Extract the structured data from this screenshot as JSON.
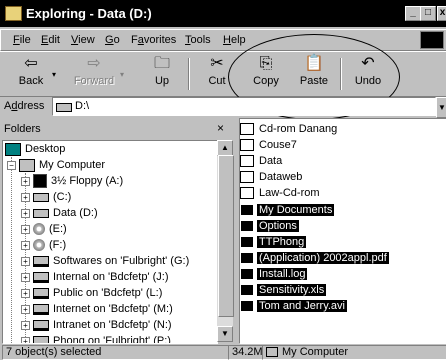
{
  "window": {
    "title": "Exploring - Data (D:)",
    "caption_buttons": {
      "minimize": "_",
      "maximize": "□",
      "close": "x"
    }
  },
  "menu": [
    {
      "label": "File",
      "accel": "F"
    },
    {
      "label": "Edit",
      "accel": "E"
    },
    {
      "label": "View",
      "accel": "V"
    },
    {
      "label": "Go",
      "accel": "G"
    },
    {
      "label": "Favorites",
      "accel": "a"
    },
    {
      "label": "Tools",
      "accel": "T"
    },
    {
      "label": "Help",
      "accel": "H"
    }
  ],
  "toolbar": {
    "back": {
      "label": "Back",
      "icon": "back-arrow-icon"
    },
    "forward": {
      "label": "Forward",
      "icon": "forward-arrow-icon"
    },
    "up": {
      "label": "Up",
      "icon": "up-folder-icon"
    },
    "cut": {
      "label": "Cut",
      "icon": "scissors-icon"
    },
    "copy": {
      "label": "Copy",
      "icon": "copy-icon"
    },
    "paste": {
      "label": "Paste",
      "icon": "paste-icon"
    },
    "undo": {
      "label": "Undo",
      "icon": "undo-icon"
    }
  },
  "address": {
    "label": "Address",
    "accel": "d",
    "value": "D:\\"
  },
  "folders_pane": {
    "header": "Folders",
    "close": "×",
    "tree": [
      {
        "label": "Desktop",
        "icon": "desktop-icon"
      },
      {
        "label": "My Computer",
        "icon": "computer-icon"
      },
      {
        "label": "3½ Floppy (A:)",
        "icon": "floppy-icon"
      },
      {
        "label": "(C:)",
        "icon": "hard-drive-icon"
      },
      {
        "label": "Data (D:)",
        "icon": "hard-drive-icon"
      },
      {
        "label": "(E:)",
        "icon": "cd-drive-icon"
      },
      {
        "label": "(F:)",
        "icon": "cd-drive-icon"
      },
      {
        "label": "Softwares on 'Fulbright' (G:)",
        "icon": "network-drive-icon"
      },
      {
        "label": "Internal on 'Bdcfetp' (J:)",
        "icon": "network-drive-icon"
      },
      {
        "label": "Public on 'Bdcfetp' (L:)",
        "icon": "network-drive-icon"
      },
      {
        "label": "Internet on 'Bdcfetp' (M:)",
        "icon": "network-drive-icon"
      },
      {
        "label": "Intranet on 'Bdcfetp' (N:)",
        "icon": "network-drive-icon"
      },
      {
        "label": "Phong on 'Fulbright' (P:)",
        "icon": "network-drive-icon"
      }
    ]
  },
  "files": [
    {
      "name": "Cd-rom Danang",
      "type": "folder",
      "selected": false
    },
    {
      "name": "Couse7",
      "type": "folder",
      "selected": false
    },
    {
      "name": "Data",
      "type": "folder",
      "selected": false
    },
    {
      "name": "Dataweb",
      "type": "folder",
      "selected": false
    },
    {
      "name": "Law-Cd-rom",
      "type": "folder",
      "selected": false
    },
    {
      "name": "My Documents",
      "type": "folder",
      "selected": true
    },
    {
      "name": "Options",
      "type": "folder",
      "selected": true
    },
    {
      "name": "TTPhong",
      "type": "folder",
      "selected": true
    },
    {
      "name": "(Application) 2002appl.pdf",
      "type": "pdf",
      "selected": true
    },
    {
      "name": "Install.log",
      "type": "file",
      "selected": true
    },
    {
      "name": "Sensitivity.xls",
      "type": "excel",
      "selected": true
    },
    {
      "name": "Tom and Jerry.avi",
      "type": "video",
      "selected": true
    }
  ],
  "status": {
    "selection": "7 object(s) selected",
    "size": "34.2MB",
    "location": "My Computer"
  },
  "colors": {
    "title_bar": "#000000",
    "selection": "#000000",
    "face": "#c0c0c0"
  }
}
